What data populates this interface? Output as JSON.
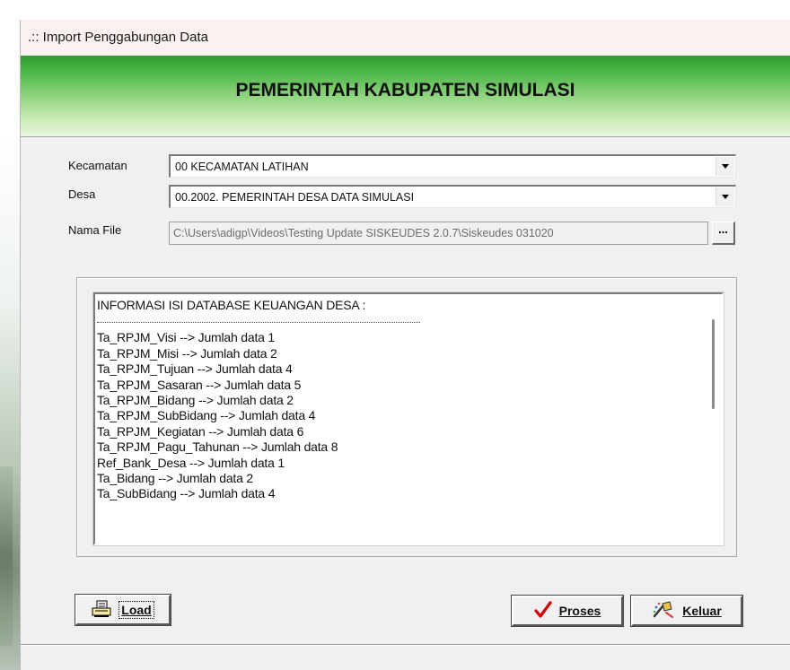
{
  "window": {
    "title": ".:: Import Penggabungan Data",
    "banner_title": "PEMERINTAH KABUPATEN SIMULASI"
  },
  "form": {
    "kecamatan_label": "Kecamatan",
    "kecamatan_value": "00  KECAMATAN LATIHAN",
    "desa_label": "Desa",
    "desa_value": "00.2002.  PEMERINTAH DESA DATA SIMULASI",
    "nama_file_label": "Nama File",
    "nama_file_value": "C:\\Users\\adigp\\Videos\\Testing Update SISKEUDES 2.0.7\\Siskeudes 031020",
    "browse_label": "..."
  },
  "info": {
    "header": "INFORMASI ISI DATABASE KEUANGAN DESA :",
    "lines": [
      "Ta_RPJM_Visi --> Jumlah data 1",
      "Ta_RPJM_Misi --> Jumlah data 2",
      "Ta_RPJM_Tujuan --> Jumlah data 4",
      "Ta_RPJM_Sasaran --> Jumlah data 5",
      "Ta_RPJM_Bidang --> Jumlah data 2",
      "Ta_RPJM_SubBidang --> Jumlah data 4",
      "Ta_RPJM_Kegiatan --> Jumlah data 6",
      "Ta_RPJM_Pagu_Tahunan --> Jumlah data 8",
      "Ref_Bank_Desa --> Jumlah data 1",
      "Ta_Bidang --> Jumlah data 2",
      "Ta_SubBidang --> Jumlah data 4"
    ]
  },
  "buttons": {
    "load_label": "Load",
    "proses_label": "Proses",
    "keluar_label": "Keluar"
  },
  "icons": {
    "load": "load-icon",
    "proses": "checkmark-icon",
    "keluar": "exit-icon",
    "dropdown": "chevron-down-icon"
  },
  "colors": {
    "banner_green": "#4fb84a",
    "checkmark_red": "#d40000"
  }
}
